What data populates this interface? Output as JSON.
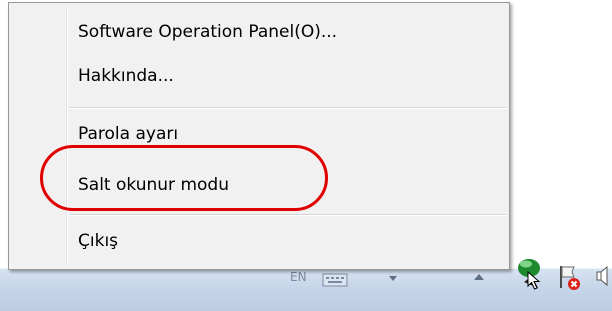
{
  "context_menu": {
    "items": [
      {
        "label": "Software Operation Panel(O)..."
      },
      {
        "label": "Hakkında..."
      },
      {
        "label": "Parola ayarı"
      },
      {
        "label": "Salt okunur modu"
      },
      {
        "label": "Çıkış"
      }
    ],
    "highlighted_item_index": 3
  },
  "taskbar": {
    "language_indicator": "EN",
    "tray_icons": [
      "keyboard-icon",
      "show-hidden-icons-icon",
      "scanner-status-icon",
      "action-center-flag-icon",
      "speaker-icon"
    ]
  },
  "colors": {
    "menu_background": "#f1f1f1",
    "annotation_ring": "#e00000",
    "scanner_icon": "#1e8a2e"
  }
}
